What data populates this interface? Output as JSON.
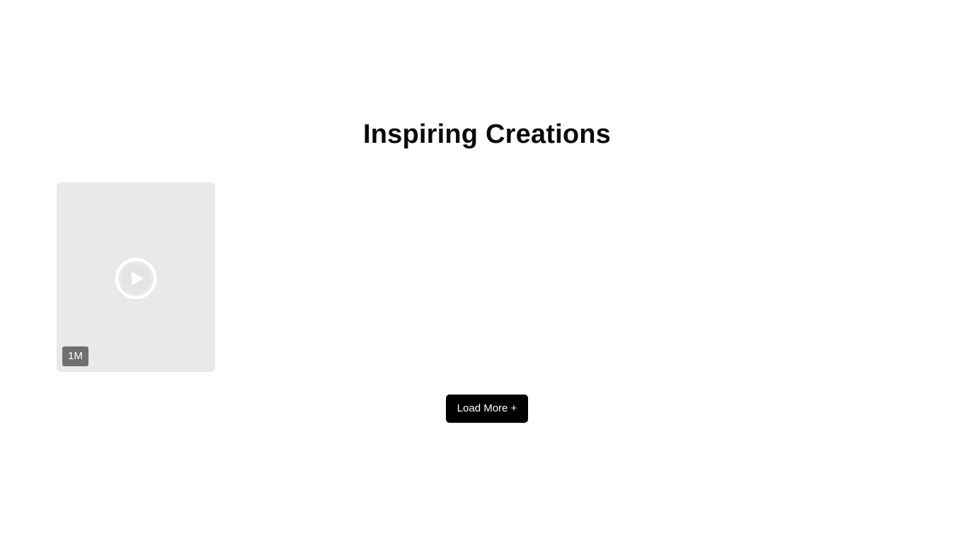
{
  "section": {
    "title": "Inspiring Creations"
  },
  "gallery": {
    "items": [
      {
        "icon": "play-icon",
        "badge": "1M"
      }
    ]
  },
  "actions": {
    "load_more_label": "Load More +"
  },
  "colors": {
    "card_background": "#e9e9e9",
    "badge_background": "#6f6f6f",
    "button_background": "#000000",
    "button_text": "#ffffff",
    "title_text": "#0a0a0a"
  }
}
